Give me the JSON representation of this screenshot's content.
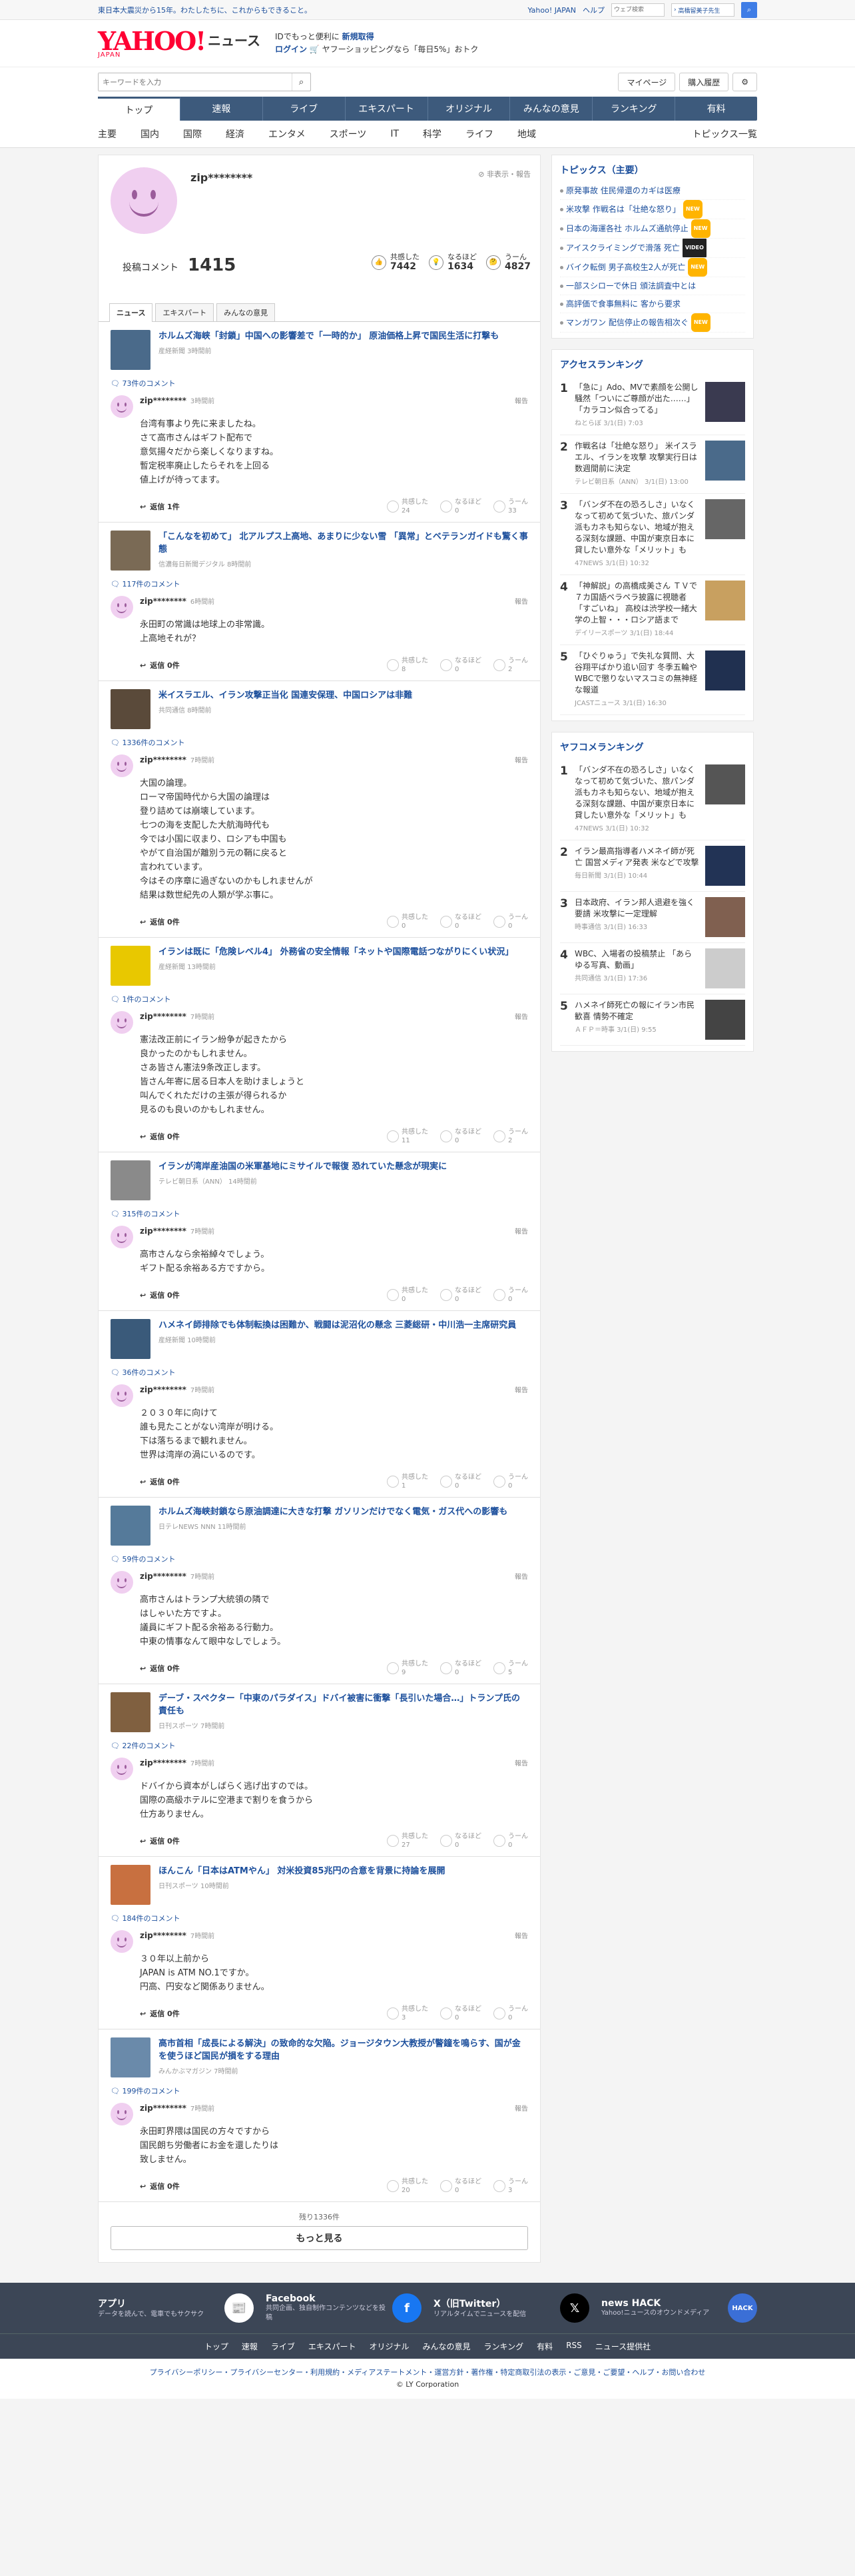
{
  "topbar": {
    "message": "東日本大震災から15年。わたしたちに、これからもできること。",
    "links": [
      "Yahoo! JAPAN",
      "ヘルプ"
    ],
    "search_placeholder": "ウェブ検索",
    "trend": "高橋留美子先生"
  },
  "header": {
    "logo": "YAHOO!",
    "logo_sub": "JAPAN",
    "logo_news": "ニュース",
    "promo_line1_a": "IDでもっと便利に",
    "promo_line1_b": "新規取得",
    "promo_line2_a": "ログイン",
    "promo_line2_b": "ヤフーショッピングなら「毎日5%」おトク"
  },
  "search": {
    "placeholder": "キーワードを入力",
    "mypage": "マイページ",
    "history": "購入履歴"
  },
  "nav": [
    "トップ",
    "速報",
    "ライブ",
    "エキスパート",
    "オリジナル",
    "みんなの意見",
    "ランキング",
    "有料"
  ],
  "subnav": [
    "主要",
    "国内",
    "国際",
    "経済",
    "エンタメ",
    "スポーツ",
    "IT",
    "科学",
    "ライフ",
    "地域"
  ],
  "subnav_last": "トピックス一覧",
  "profile": {
    "name": "zip********",
    "hide": "非表示・報告",
    "label": "投稿コメント",
    "count": "1415",
    "reacts": [
      {
        "l": "共感した",
        "v": "7442"
      },
      {
        "l": "なるほど",
        "v": "1634"
      },
      {
        "l": "うーん",
        "v": "4827"
      }
    ]
  },
  "tabs": [
    "ニュース",
    "エキスパート",
    "みんなの意見"
  ],
  "labels": {
    "reply": "返信 ",
    "report": "報告",
    "empathy": "共感した",
    "naruhodo": "なるほど",
    "uun": "うーん"
  },
  "items": [
    {
      "title": "ホルムズ海峡「封鎖」中国への影響差で「一時的か」 原油価格上昇で国民生活に打撃も",
      "src": "産経新聞 3時間前",
      "cc": "73件のコメント",
      "time": "3時間前",
      "body": "台湾有事より先に来ましたね。\nさて高市さんはギフト配布で\n意気揚々だから楽しくなりますね。\n暫定税率廃止したらそれを上回る\n値上げが待ってます。",
      "reply": "返信 1件",
      "r": [
        "24",
        "0",
        "33"
      ],
      "c": "#4a6a8a"
    },
    {
      "title": "「こんなを初めて」 北アルプス上高地、あまりに少ない雪 「異常」とベテランガイドも驚く事態",
      "src": "信濃毎日新聞デジタル 8時間前",
      "cc": "117件のコメント",
      "time": "6時間前",
      "body": "永田町の常識は地球上の非常識。\n上高地それが？",
      "reply": "返信 0件",
      "r": [
        "8",
        "0",
        "2"
      ],
      "c": "#7a6a55"
    },
    {
      "title": "米イスラエル、イラン攻撃正当化 国連安保理、中国ロシアは非難",
      "src": "共同通信 8時間前",
      "cc": "1336件のコメント",
      "time": "7時間前",
      "body": "大国の論理。\nローマ帝国時代から大国の論理は\n登り詰めては崩壊しています。\n七つの海を支配した大航海時代も\n今では小国に収まり、ロシアも中国も\nやがて自治国が離別う元の鞘に戻ると\n言われています。\n今はその序章に過ぎないのかもしれませんが\n結果は数世紀先の人類が学ぶ事に。",
      "reply": "返信 0件",
      "r": [
        "0",
        "0",
        "0"
      ],
      "c": "#5a4a3a"
    },
    {
      "title": "イランは既に「危険レベル4」 外務省の安全情報「ネットや国際電話つながりにくい状況」",
      "src": "産経新聞 13時間前",
      "cc": "1件のコメント",
      "time": "7時間前",
      "body": "憲法改正前にイラン紛争が起きたから\n良かったのかもしれません。\nさあ皆さん憲法9条改正します。\n皆さん年寄に居る日本人を助けましょうと\n叫んでくれただけの主張が得られるか\n見るのも良いのかもしれません。",
      "reply": "返信 0件",
      "r": [
        "11",
        "0",
        "2"
      ],
      "c": "#e8c800"
    },
    {
      "title": "イランが湾岸産油国の米軍基地にミサイルで報復 恐れていた懸念が現実に",
      "src": "テレビ朝日系（ANN） 14時間前",
      "cc": "315件のコメント",
      "time": "7時間前",
      "body": "高市さんなら余裕綽々でしょう。\nギフト配る余裕ある方ですから。",
      "reply": "返信 0件",
      "r": [
        "0",
        "0",
        "0"
      ],
      "c": "#8a8a8a"
    },
    {
      "title": "ハメネイ師排除でも体制転換は困難か、戦闘は泥沼化の懸念 三菱総研・中川浩一主席研究員",
      "src": "産経新聞 10時間前",
      "cc": "36件のコメント",
      "time": "7時間前",
      "body": "２０３０年に向けて\n誰も見たことがない湾岸が明ける。\n下は落ちるまで観れません。\n世界は湾岸の渦にいるのです。",
      "reply": "返信 0件",
      "r": [
        "1",
        "0",
        "0"
      ],
      "c": "#3a5a7a"
    },
    {
      "title": "ホルムズ海峡封鎖なら原油調達に大きな打撃 ガソリンだけでなく電気・ガス代への影響も",
      "src": "日テレNEWS NNN 11時間前",
      "cc": "59件のコメント",
      "time": "7時間前",
      "body": "高市さんはトランプ大統領の隣で\nはしゃいた方ですよ。\n議員にギフト配る余裕ある行動力。\n中東の情事なんて眼中なしでしょう。",
      "reply": "返信 0件",
      "r": [
        "9",
        "0",
        "5"
      ],
      "c": "#557a9a"
    },
    {
      "title": "デーブ・スペクター「中東のパラダイス」ドバイ被害に衝撃「長引いた場合…」トランプ氏の責任も",
      "src": "日刊スポーツ 7時間前",
      "cc": "22件のコメント",
      "time": "7時間前",
      "body": "ドバイから資本がしばらく逃げ出すのでは。\n国際の高級ホテルに空港まで割りを食うから\n仕方ありません。",
      "reply": "返信 0件",
      "r": [
        "27",
        "0",
        "0"
      ],
      "c": "#806040"
    },
    {
      "title": "ほんこん「日本はATMやん」 対米投資85兆円の合意を背景に持論を展開",
      "src": "日刊スポーツ 10時間前",
      "cc": "184件のコメント",
      "time": "7時間前",
      "body": "３０年以上前から\nJAPAN is ATM NO.1ですか。\n円高、円安など関係ありません。",
      "reply": "返信 0件",
      "r": [
        "3",
        "0",
        "0"
      ],
      "c": "#c87040"
    },
    {
      "title": "高市首相「成長による解決」の致命的な欠陥。ジョージタウン大教授が警鐘を鳴らす、国が金を使うほど国民が損をする理由",
      "src": "みんかぶマガジン 7時間前",
      "cc": "199件のコメント",
      "time": "7時間前",
      "body": "永田町界隈は国民の方々ですから\n国民朗ち労働者にお金を還したりは\n致しません。",
      "reply": "返信 0件",
      "r": [
        "20",
        "0",
        "3"
      ],
      "c": "#6a8aaa"
    }
  ],
  "more": {
    "remaining": "残り1336件",
    "label": "もっと見る"
  },
  "topics": {
    "title": "トピックス（主要）",
    "items": [
      {
        "t": "原発事故 住民帰還のカギは医療",
        "b": ""
      },
      {
        "t": "米攻撃 作戦名は「壮絶な怒り」",
        "b": "NEW"
      },
      {
        "t": "日本の海運各社 ホルムズ通航停止",
        "b": "NEW"
      },
      {
        "t": "アイスクライミングで滑落 死亡",
        "b": "VIDEO"
      },
      {
        "t": "バイク転倒 男子高校生2人が死亡",
        "b": "NEW"
      },
      {
        "t": "一部スシローで休日 頒法調査中とは",
        "b": ""
      },
      {
        "t": "高評価で食事無料に 客から要求",
        "b": ""
      },
      {
        "t": "マンガワン 配信停止の報告相次ぐ",
        "b": "NEW"
      }
    ]
  },
  "access": {
    "title": "アクセスランキング",
    "items": [
      {
        "n": "1",
        "t": "「急に」Ado、MVで素顔を公開し騒然「ついにご尊顔が出た……」「カラコン似合ってる」",
        "s": "ねとらぼ 3/1(日) 7:03",
        "c": "#3a3a50"
      },
      {
        "n": "2",
        "t": "作戦名は「壮絶な怒り」 米イスラエル、イランを攻撃 攻撃実行日は数週間前に決定",
        "s": "テレビ朝日系（ANN） 3/1(日) 13:00",
        "c": "#4a6a8a"
      },
      {
        "n": "3",
        "t": "「バンダ不在の恐ろしさ」いなくなって初めて気づいた、旅パンダ派もカネも知らない、地域が抱える深刻な課題、中国が東京日本に貸したい意外な「メリット」も",
        "s": "47NEWS 3/1(日) 10:32",
        "c": "#666"
      },
      {
        "n": "4",
        "t": "「神解説」の高橋成美さん ＴＶで７カ国語ペラペラ披露に視聴者「すごいね」 高校は渋学校一緒大学の上智・・・ロシア語まで",
        "s": "デイリースポーツ 3/1(日) 18:44",
        "c": "#c8a060"
      },
      {
        "n": "5",
        "t": "「ひぐりゅう」で失礼な質問、大谷翔平ばかり追い回す 冬季五輪やWBCで懲りないマスコミの無神経な報道",
        "s": "JCASTニュース 3/1(日) 16:30",
        "c": "#203050"
      }
    ]
  },
  "yahoo": {
    "title": "ヤフコメランキング",
    "items": [
      {
        "n": "1",
        "t": "「バンダ不在の恐ろしさ」いなくなって初めて気づいた、旅パンダ派もカネも知らない、地域が抱える深刻な課題、中国が東京日本に貸したい意外な「メリット」も",
        "s": "47NEWS 3/1(日) 10:32",
        "c": "#555"
      },
      {
        "n": "2",
        "t": "イラン最高指導者ハメネイ師が死亡 国営メディア発表 米などで攻撃",
        "s": "毎日新聞 3/1(日) 10:44",
        "c": "#223355"
      },
      {
        "n": "3",
        "t": "日本政府、イラン邦人退避を強く要請 米攻撃に一定理解",
        "s": "時事通信 3/1(日) 16:33",
        "c": "#806050"
      },
      {
        "n": "4",
        "t": "WBC、入場者の投稿禁止 「あらゆる写真、動画」",
        "s": "共同通信 3/1(日) 17:36",
        "c": "#ccc"
      },
      {
        "n": "5",
        "t": "ハメネイ師死亡の報にイラン市民歓喜 情勢不確定",
        "s": "ＡＦＰ＝時事 3/1(日) 9:55",
        "c": "#444"
      }
    ]
  },
  "footer": {
    "apps": [
      {
        "h": "アプリ",
        "d": "データを読んで、電車でもサクサク",
        "i": "📰",
        "c": "#fff",
        "fc": "#333"
      },
      {
        "h": "Facebook",
        "d": "共同企画、独自制作コンテンツなどを投稿",
        "i": "f",
        "c": "#1877f2",
        "fc": "#fff"
      },
      {
        "h": "X（旧Twitter）",
        "d": "リアルタイムでニュースを配信",
        "i": "𝕏",
        "c": "#000",
        "fc": "#fff"
      },
      {
        "h": "news HACK",
        "d": "Yahoo!ニュースのオウンドメディア",
        "i": "HACK",
        "c": "#3b6fd6",
        "fc": "#fff"
      }
    ],
    "links": [
      "トップ",
      "速報",
      "ライブ",
      "エキスパート",
      "オリジナル",
      "みんなの意見",
      "ランキング",
      "有料",
      "RSS",
      "ニュース提供社"
    ],
    "policy": "プライバシーポリシー・プライバシーセンター・利用規約・メディアステートメント・運営方針・著作権・特定商取引法の表示・ご意見・ご要望・ヘルプ・お問い合わせ",
    "copy": "© LY Corporation"
  }
}
